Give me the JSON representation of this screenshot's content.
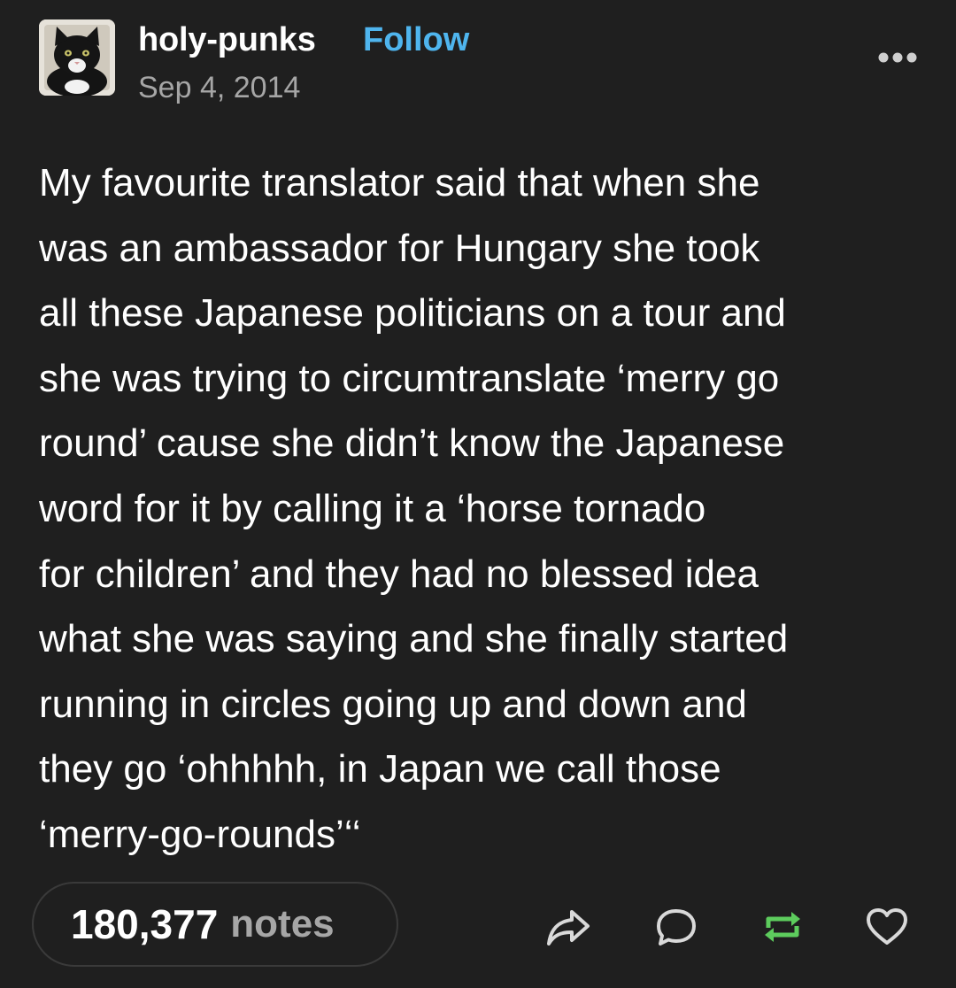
{
  "post": {
    "username": "holy-punks",
    "follow_label": "Follow",
    "date": "Sep 4, 2014",
    "body_lines": [
      "My favourite translator said that when she",
      "was an ambassador for Hungary she took",
      "all these Japanese politicians on a tour and",
      "she was trying to circumtranslate ‘merry go",
      "round’ cause she didn’t know the Japanese",
      "word for it by calling it a ‘horse tornado",
      "for children’ and they had no blessed idea",
      "what she was saying and she finally started",
      "running in circles going up and down and",
      "they go ‘ohhhhh, in Japan we call those",
      "‘merry-go-rounds’‘‘"
    ]
  },
  "footer": {
    "notes_count": "180,377",
    "notes_label": "notes",
    "actions": {
      "share_icon": "share-icon",
      "reply_icon": "reply-icon",
      "reblog_icon": "reblog-icon",
      "like_icon": "heart-icon"
    }
  },
  "colors": {
    "background": "#1f1f1f",
    "text": "#ffffff",
    "muted": "#a6a6a6",
    "follow": "#4fb5ee",
    "reblog": "#5dcc5d"
  }
}
